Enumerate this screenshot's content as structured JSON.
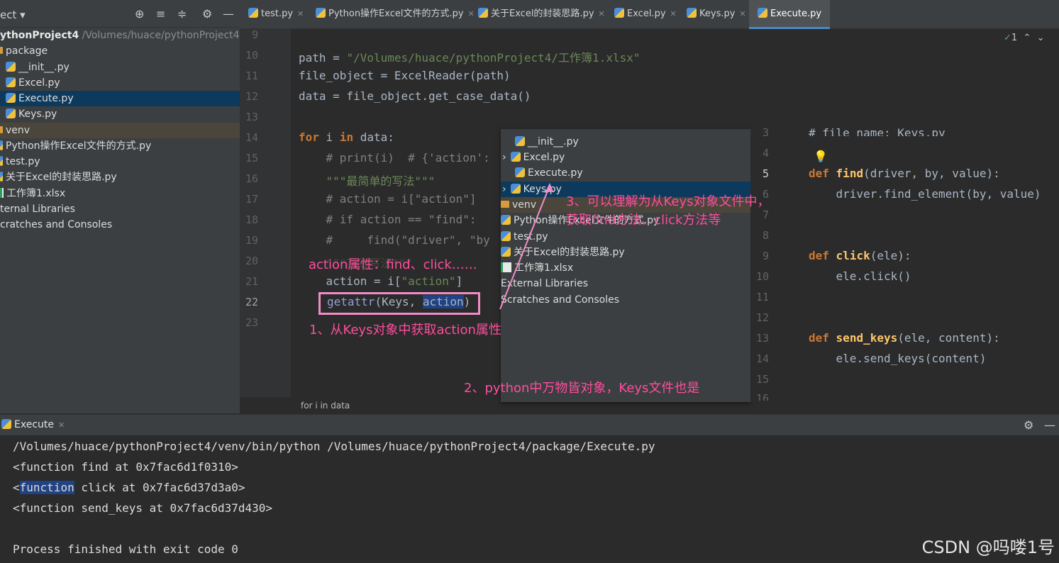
{
  "project": {
    "title": "ect",
    "root_name": "ythonProject4",
    "root_path": "/Volumes/huace/pythonProject4",
    "items": [
      {
        "label": "package",
        "kind": "folder"
      },
      {
        "label": "__init__.py",
        "kind": "py"
      },
      {
        "label": "Excel.py",
        "kind": "py"
      },
      {
        "label": "Execute.py",
        "kind": "py"
      },
      {
        "label": "Keys.py",
        "kind": "py"
      },
      {
        "label": "venv",
        "kind": "folder"
      },
      {
        "label": "Python操作Excel文件的方式.py",
        "kind": "py"
      },
      {
        "label": "test.py",
        "kind": "py"
      },
      {
        "label": "关于Excel的封装思路.py",
        "kind": "py"
      },
      {
        "label": "工作簿1.xlsx",
        "kind": "xlsx"
      },
      {
        "label": "ternal Libraries",
        "kind": "lib"
      },
      {
        "label": "cratches and Consoles",
        "kind": "scratch"
      }
    ]
  },
  "tabs": [
    {
      "label": "test.py"
    },
    {
      "label": "Python操作Excel文件的方式.py"
    },
    {
      "label": "关于Excel的封装思路.py"
    },
    {
      "label": "Excel.py"
    },
    {
      "label": "Keys.py"
    },
    {
      "label": "Execute.py"
    }
  ],
  "editor": {
    "inspection_count": "1",
    "line_numbers": [
      "9",
      "10",
      "11",
      "12",
      "13",
      "14",
      "15",
      "16",
      "17",
      "18",
      "19",
      "20",
      "21",
      "22",
      "23"
    ],
    "lines": {
      "l10a": "path = ",
      "l10b": "\"/Volumes/huace/pythonProject4/工作簿1.xlsx\"",
      "l11": "file_object = ExcelReader(path)",
      "l12": "data = file_object.get_case_data()",
      "l14kw1": "for",
      "l14b": " i ",
      "l14kw2": "in",
      "l14c": " data:",
      "l15": "    # print(i)  # {'action':",
      "l16": "    \"\"\"最简单的写法\"\"\"",
      "l17": "    # action = i[\"action\"]",
      "l18": "    # if action == \"find\":",
      "l19": "    #     find(\"driver\", \"by",
      "l20": "    \"\"\"高级写法\"\"\"",
      "l21a": "    action = i[",
      "l21b": "\"action\"",
      "l21c": "]",
      "l22a": "getattr",
      "l22b": "(Keys, ",
      "l22c": "action",
      "l22d": ")"
    },
    "breadcrumb": "for i in data"
  },
  "popup_tree": [
    {
      "label": "__init__.py",
      "kind": "py"
    },
    {
      "label": "Excel.py",
      "kind": "py"
    },
    {
      "label": "Execute.py",
      "kind": "py"
    },
    {
      "label": "Keys.py",
      "kind": "py"
    },
    {
      "label": "venv",
      "kind": "folder"
    },
    {
      "label": "Python操作Excel文件的方式.py",
      "kind": "py"
    },
    {
      "label": "test.py",
      "kind": "py"
    },
    {
      "label": "关于Excel的封装思路.py",
      "kind": "py"
    },
    {
      "label": "工作簿1.xlsx",
      "kind": "xlsx"
    },
    {
      "label": "External Libraries",
      "kind": "lib"
    },
    {
      "label": "Scratches and Consoles",
      "kind": "scratch"
    }
  ],
  "keys_preview": {
    "line_numbers": [
      "3",
      "4",
      "5",
      "6",
      "7",
      "8",
      "9",
      "10",
      "11",
      "12",
      "13",
      "14",
      "15",
      "16"
    ],
    "l3": "# file name: Keys.py",
    "def": "def",
    "find_name": "find",
    "find_args": "(driver, by, value):",
    "find_body": "    driver.find_element(by, value)",
    "click_name": "click",
    "click_args": "(ele):",
    "click_body": "    ele.click()",
    "send_name": "send_keys",
    "send_args": "(ele, content):",
    "send_body": "    ele.send_keys(content)"
  },
  "annotations": {
    "a0": "action属性：find、click……",
    "a1": "1、从Keys对象中获取action属性",
    "a2": "2、python中万物皆对象，Keys文件也是",
    "a3_line1": "3、可以理解为从Keys对象文件中，",
    "a3_line2": "获取find方法、click方法等"
  },
  "run": {
    "tab_label": "Execute",
    "lines": [
      "/Volumes/huace/pythonProject4/venv/bin/python /Volumes/huace/pythonProject4/package/Execute.py",
      "<function find at 0x7fac6d1f0310>",
      "function",
      " click at 0x7fac6d37d3a0>",
      "<function send_keys at 0x7fac6d37d430>",
      "Process finished with exit code 0"
    ],
    "lt": "<"
  },
  "watermark": "CSDN @吗喽1号"
}
